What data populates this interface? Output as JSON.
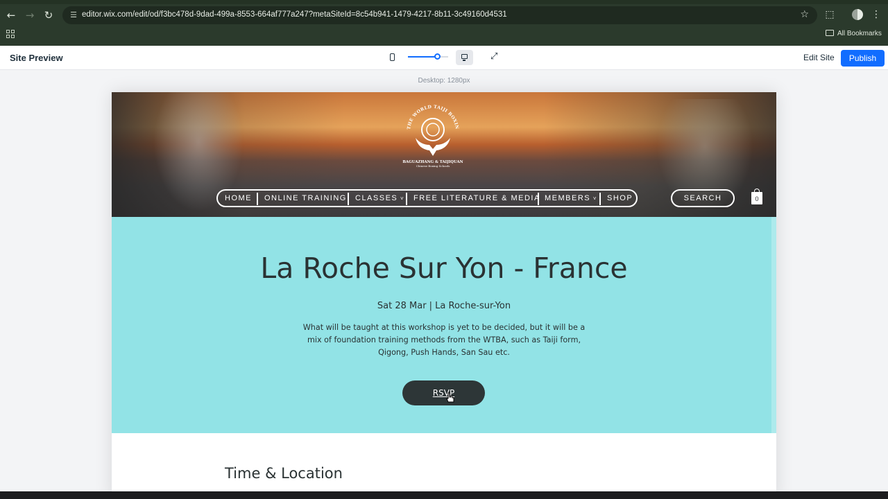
{
  "browser": {
    "url": "editor.wix.com/edit/od/f3bc478d-9dad-499a-8553-664af777a247?metaSiteId=8c54b941-1479-4217-8b11-3c49160d4531",
    "bookmarks_label": "All Bookmarks",
    "icons": {
      "back": "arrow-left-icon",
      "forward": "arrow-right-icon",
      "reload": "reload-icon",
      "site_info": "tune-icon",
      "bookmark": "star-icon",
      "extensions": "puzzle-icon",
      "profile": "profile-icon",
      "menu": "kebab-menu-icon",
      "apps": "apps-grid-icon"
    }
  },
  "wix": {
    "title": "Site Preview",
    "edit_site": "Edit Site",
    "publish": "Publish",
    "viewport_label": "Desktop: 1280px",
    "zoom_level": 0.72,
    "accent": "#116dff"
  },
  "site": {
    "logo_text_top": "THE WORLD TAIJI BOXING ASSOCIATION",
    "logo_text_bottom": "BAGUAZHANG & TAIJIQUAN",
    "logo_text_sub": "Chinese Boxing Schools",
    "nav": [
      "HOME",
      "ONLINE TRAINING",
      "CLASSES",
      "FREE LITERATURE & MEDIA",
      "MEMBERS",
      "SHOP"
    ],
    "search": "SEARCH",
    "cart_count": "0",
    "event": {
      "title": "La Roche Sur Yon - France",
      "meta": "Sat 28 Mar  |  La Roche-sur-Yon",
      "description": "What will be taught at this workshop is yet to be decided, but it will be a mix of foundation training methods from the WTBA, such as Taiji form, Qigong, Push Hands, San Sau etc.",
      "rsvp": "RSVP",
      "bg_color": "#92e3e6"
    },
    "section_heading": "Time & Location"
  }
}
